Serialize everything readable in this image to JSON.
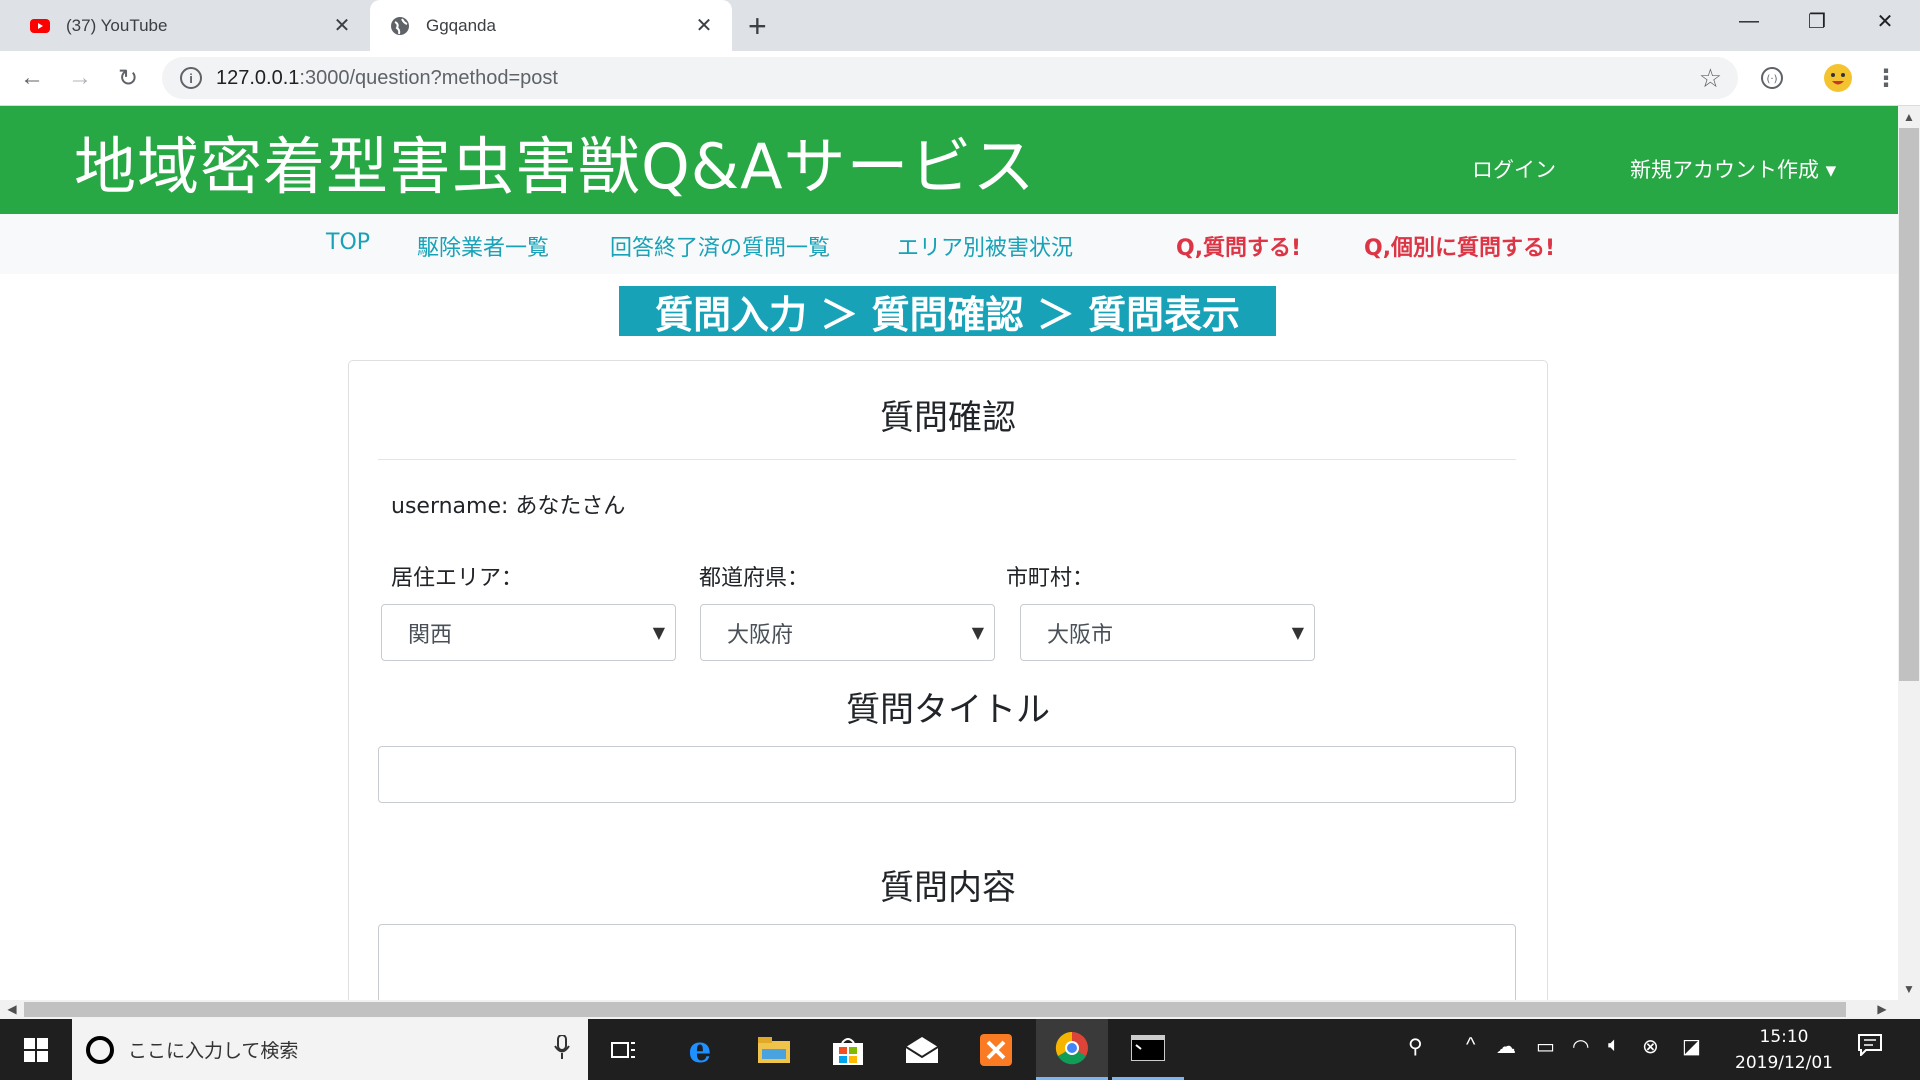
{
  "browser": {
    "tabs": [
      {
        "title": "(37) YouTube",
        "icon": "youtube-icon"
      },
      {
        "title": "Ggqanda",
        "icon": "globe-icon"
      }
    ],
    "new_tab": "+",
    "url_host": "127.0.0.1",
    "url_rest": ":3000/question?method=post"
  },
  "site": {
    "brand": "地域密着型害虫害獣Q&Aサービス",
    "login": "ログイン",
    "signup": "新規アカウント作成 ▾",
    "nav": [
      "TOP",
      "駆除業者一覧",
      "回答終了済の質問一覧",
      "エリア別被害状況"
    ],
    "nav_red": [
      "Q,質問する!",
      "Q,個別に質問する!"
    ],
    "steps": "質問入力 ＞ 質問確認 ＞ 質問表示"
  },
  "form": {
    "heading": "質問確認",
    "username": "username: あなたさん",
    "area_label": "居住エリア：",
    "pref_label": "都道府県：",
    "city_label": "市町村：",
    "area_value": "関西",
    "pref_value": "大阪府",
    "city_value": "大阪市",
    "title_heading": "質問タイトル",
    "title_value": "",
    "content_heading": "質問内容",
    "content_value": ""
  },
  "taskbar": {
    "search_placeholder": "ここに入力して検索",
    "time": "15:10",
    "date": "2019/12/01"
  },
  "colors": {
    "header_green": "#28a745",
    "link_teal": "#17a2b8",
    "link_red": "#dc3545"
  }
}
